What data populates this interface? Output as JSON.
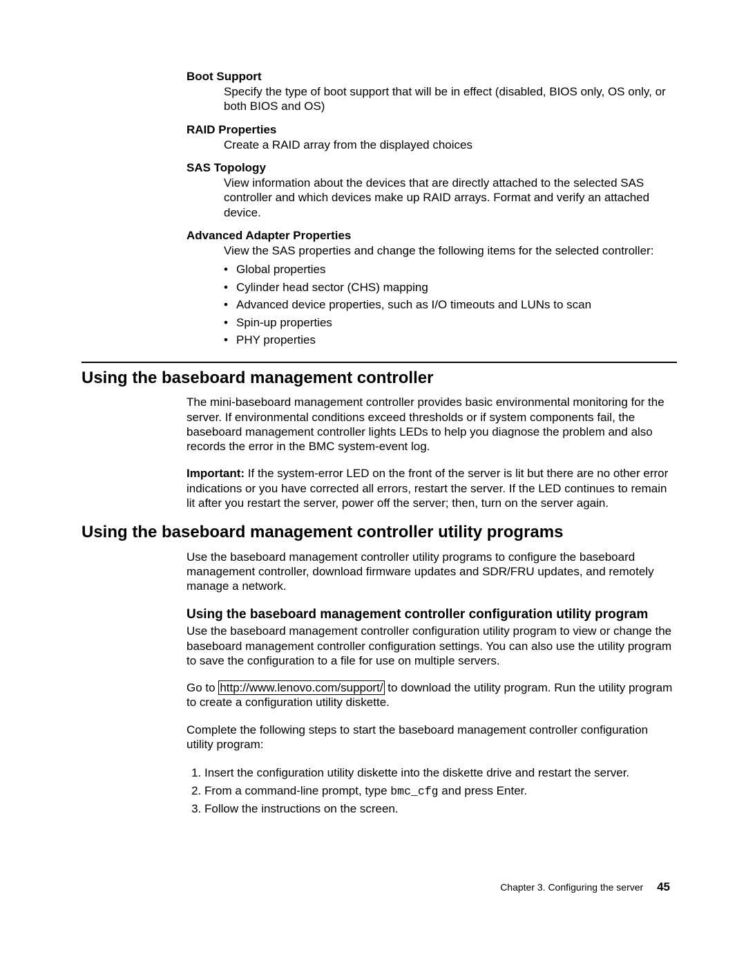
{
  "definitions": [
    {
      "term": "Boot Support",
      "desc": "Specify the type of boot support that will be in effect (disabled, BIOS only, OS only, or both BIOS and OS)"
    },
    {
      "term": "RAID Properties",
      "desc": "Create a RAID array from the displayed choices"
    },
    {
      "term": "SAS Topology",
      "desc": "View information about the devices that are directly attached to the selected SAS controller and which devices make up RAID arrays. Format and verify an attached device."
    },
    {
      "term": "Advanced Adapter Properties",
      "desc": "View the SAS properties and change the following items for the selected controller:",
      "bullets": [
        "Global properties",
        "Cylinder head sector (CHS) mapping",
        "Advanced device properties, such as I/O timeouts and LUNs to scan",
        "Spin-up properties",
        "PHY properties"
      ]
    }
  ],
  "section1": {
    "heading": "Using the baseboard management controller",
    "p1": "The mini-baseboard management controller provides basic environmental monitoring for the server. If environmental conditions exceed thresholds or if system components fail, the baseboard management controller lights LEDs to help you diagnose the problem and also records the error in the BMC system-event log.",
    "important_label": "Important:",
    "important_text": " If the system-error LED on the front of the server is lit but there are no other error indications or you have corrected all errors, restart the server. If the LED continues to remain lit after you restart the server, power off the server; then, turn on the server again."
  },
  "section2": {
    "heading": "Using the baseboard management controller utility programs",
    "p1": "Use the baseboard management controller utility programs to configure the baseboard management controller, download firmware updates and SDR/FRU updates, and remotely manage a network.",
    "sub_heading": "Using the baseboard management controller configuration utility program",
    "p2": "Use the baseboard management controller configuration utility program to view or change the baseboard management controller configuration settings. You can also use the utility program to save the configuration to a file for use on multiple servers.",
    "p3_pre": "Go to ",
    "p3_link": "http://www.lenovo.com/support/",
    "p3_post": " to download the utility program. Run the utility program to create a configuration utility diskette.",
    "p4": "Complete the following steps to start the baseboard management controller configuration utility program:",
    "steps": [
      "Insert the configuration utility diskette into the diskette drive and restart the server.",
      "From a command-line prompt, type ",
      "Follow the instructions on the screen."
    ],
    "step2_code": "bmc_cfg",
    "step2_post": " and press Enter."
  },
  "footer": {
    "chapter": "Chapter 3. Configuring the server",
    "page": "45"
  }
}
